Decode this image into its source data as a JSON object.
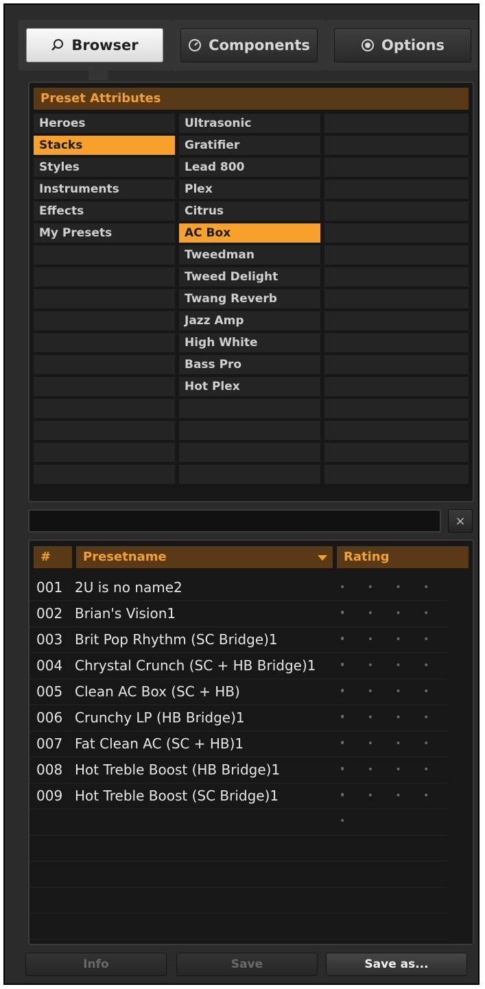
{
  "tabs": [
    {
      "label": "Browser",
      "icon": "search-icon",
      "active": true
    },
    {
      "label": "Components",
      "icon": "gauge-icon",
      "active": false
    },
    {
      "label": "Options",
      "icon": "radio-icon",
      "active": false
    }
  ],
  "attributes": {
    "header": "Preset Attributes",
    "categories": [
      "Heroes",
      "Stacks",
      "Styles",
      "Instruments",
      "Effects",
      "My Presets"
    ],
    "selected_category": "Stacks",
    "amps": [
      "Ultrasonic",
      "Gratifier",
      "Lead 800",
      "Plex",
      "Citrus",
      "AC Box",
      "Tweedman",
      "Tweed Delight",
      "Twang Reverb",
      "Jazz Amp",
      "High White",
      "Bass Pro",
      "Hot Plex"
    ],
    "selected_amp": "AC Box"
  },
  "search": {
    "value": "",
    "clear_label": "×"
  },
  "list": {
    "col_num": "#",
    "col_name": "Presetname",
    "col_rating": "Rating",
    "rows": [
      {
        "num": "001",
        "name": "2U is no name2",
        "rating": "• • • • •"
      },
      {
        "num": "002",
        "name": "Brian's Vision1",
        "rating": "• • • • •"
      },
      {
        "num": "003",
        "name": "Brit Pop Rhythm (SC Bridge)1",
        "rating": "• • • • •"
      },
      {
        "num": "004",
        "name": "Chrystal Crunch (SC + HB Bridge)1",
        "rating": "• • • • •"
      },
      {
        "num": "005",
        "name": "Clean AC Box (SC + HB)",
        "rating": "• • • • •"
      },
      {
        "num": "006",
        "name": "Crunchy LP   (HB Bridge)1",
        "rating": "• • • • •"
      },
      {
        "num": "007",
        "name": "Fat Clean AC (SC + HB)1",
        "rating": "• • • • •"
      },
      {
        "num": "008",
        "name": "Hot Treble Boost (HB Bridge)1",
        "rating": "• • • • •"
      },
      {
        "num": "009",
        "name": "Hot Treble Boost (SC Bridge)1",
        "rating": "• • • • •"
      }
    ]
  },
  "buttons": {
    "info": "Info",
    "save": "Save",
    "save_as": "Save as..."
  },
  "colors": {
    "accent": "#f8a22b",
    "header_bg": "#5a3a16",
    "header_text": "#f2a02f"
  }
}
